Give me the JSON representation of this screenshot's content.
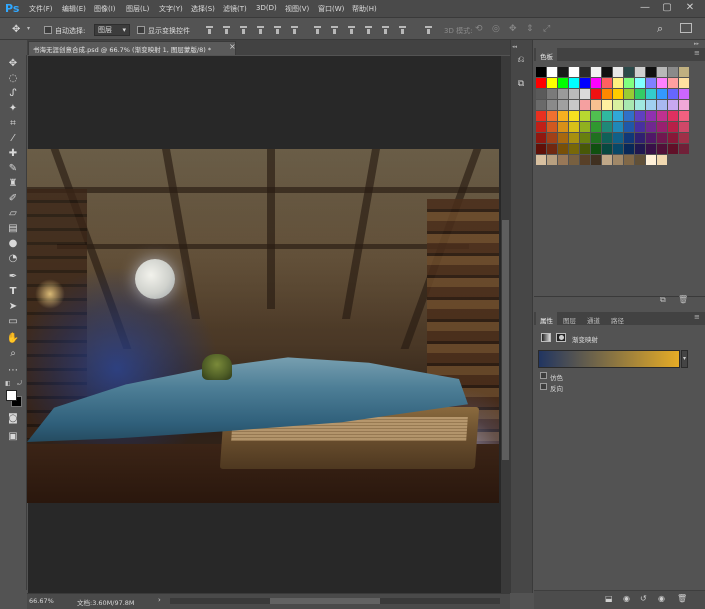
{
  "app": {
    "logo": "Ps",
    "menu": [
      "文件(F)",
      "编辑(E)",
      "图像(I)",
      "图层(L)",
      "文字(Y)",
      "选择(S)",
      "滤镜(T)",
      "3D(D)",
      "视图(V)",
      "窗口(W)",
      "帮助(H)"
    ],
    "window_controls": [
      "—",
      "▢",
      "✕"
    ]
  },
  "options_bar": {
    "auto_select_label": "自动选择:",
    "auto_select_value": "图层",
    "show_transform_label": "显示变换控件",
    "mode_3d_label": "3D 模式:"
  },
  "document": {
    "tab_title": "书海无涯创意合成.psd @ 66.7% (渐变映射 1, 图层蒙版/8) *",
    "close_glyph": "×"
  },
  "status": {
    "zoom": "66.67%",
    "doc_size": "文档:3.60M/97.8M",
    "arrow": "›"
  },
  "swatches_panel": {
    "tab": "色板",
    "colors": [
      "#000000",
      "#ffffff",
      "#1a1a1a",
      "#ffffff",
      "#2a2a2a",
      "#f2f2f2",
      "#101010",
      "#e8e8e8",
      "#2c4a4a",
      "#d0d0d0",
      "#101010",
      "#b8b8b8",
      "#8a8a8a",
      "#c0b080",
      "#ff0000",
      "#ffff00",
      "#00ff00",
      "#00ffff",
      "#0000ff",
      "#ff00ff",
      "#ff6060",
      "#fff080",
      "#80ff80",
      "#80ffff",
      "#8080ff",
      "#ff80ff",
      "#ffa0a0",
      "#ffe0a0",
      "#5a5a5a",
      "#7a7a7a",
      "#9a9a9a",
      "#bababa",
      "#dadada",
      "#ee1111",
      "#ff8800",
      "#ffcc00",
      "#99cc33",
      "#33cc66",
      "#33cccc",
      "#3399ff",
      "#6666ff",
      "#cc66ff",
      "#6a6a6a",
      "#8a8a8a",
      "#a0a0a0",
      "#c8c8c8",
      "#f5a0a0",
      "#f8c090",
      "#fff0a0",
      "#d8f0a0",
      "#a8e8b0",
      "#a0e8e0",
      "#a0d0f0",
      "#a8b8f0",
      "#c8a8f0",
      "#f0a8d8",
      "#e83020",
      "#f07030",
      "#f8b020",
      "#f8e020",
      "#b8d830",
      "#50c050",
      "#30b8a0",
      "#30a8d8",
      "#3070c8",
      "#6040c0",
      "#9030b0",
      "#c03090",
      "#e03060",
      "#f06080",
      "#c02018",
      "#d05820",
      "#d89018",
      "#d8c018",
      "#90b020",
      "#309830",
      "#208878",
      "#2088b8",
      "#2058a8",
      "#4830a0",
      "#702890",
      "#982070",
      "#b82048",
      "#d04868",
      "#901810",
      "#a04018",
      "#a86810",
      "#a89010",
      "#688010",
      "#207020",
      "#106058",
      "#106088",
      "#103878",
      "#302070",
      "#501868",
      "#701850",
      "#881838",
      "#a03048",
      "#601008",
      "#702810",
      "#785008",
      "#786808",
      "#485808",
      "#105010",
      "#084840",
      "#084868",
      "#082858",
      "#201850",
      "#381048",
      "#501038",
      "#601028",
      "#702038",
      "#d8c0a0",
      "#b8a080",
      "#987858",
      "#786040",
      "#584028",
      "#403020",
      "#c0a888",
      "#a08868",
      "#806848",
      "#605038",
      "#fff0d8",
      "#f0d8b0"
    ],
    "footer_icons": [
      "new-swatch-icon",
      "trash-icon"
    ]
  },
  "properties_panel": {
    "tabs": [
      "属性",
      "图层",
      "通道",
      "路径"
    ],
    "title": "渐变映射",
    "gradient_from": "#213561",
    "gradient_to": "#e6ac26",
    "dither_label": "仿色",
    "reverse_label": "反向"
  }
}
